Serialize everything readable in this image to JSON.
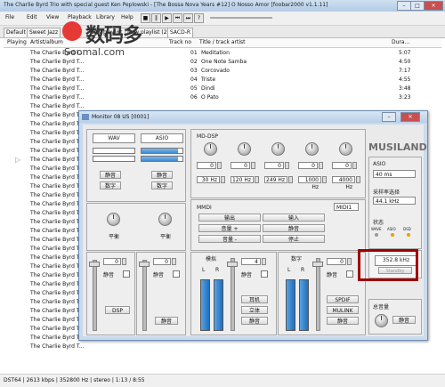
{
  "window": {
    "title": "The Charlie Byrd Trio with special guest Ken Peplowski - [The Bossa Nova Years #12] O Nosso Amor   [foobar2000 v1.1.11]"
  },
  "menu": [
    "File",
    "Edit",
    "View",
    "Playback",
    "Library",
    "Help"
  ],
  "tabs": [
    "Default",
    "Sweet Jazz",
    "New playlist",
    "New playlist (2)",
    "SACD-R"
  ],
  "active_tab": "SACD-R",
  "columns": {
    "playing": "Playing",
    "artist_album": "Artist/album",
    "track_no": "Track no",
    "title_artist": "Title / track artist",
    "duration": "Dura..."
  },
  "tracks": [
    {
      "artist": "The Charlie Byrd T...",
      "no": "01",
      "title": "Meditation",
      "dur": "5:07"
    },
    {
      "artist": "The Charlie Byrd T...",
      "no": "02",
      "title": "One Note Samba",
      "dur": "4:50"
    },
    {
      "artist": "The Charlie Byrd T...",
      "no": "03",
      "title": "Corcovado",
      "dur": "7:17"
    },
    {
      "artist": "The Charlie Byrd T...",
      "no": "04",
      "title": "Triste",
      "dur": "4:55"
    },
    {
      "artist": "The Charlie Byrd T...",
      "no": "05",
      "title": "Dindi",
      "dur": "3:48"
    },
    {
      "artist": "The Charlie Byrd T...",
      "no": "06",
      "title": "O Pato",
      "dur": "3:23"
    },
    {
      "artist": "The Charlie Byrd T...",
      "no": "",
      "title": "",
      "dur": ""
    },
    {
      "artist": "The Charlie Byrd T...",
      "no": "",
      "title": "",
      "dur": ""
    },
    {
      "artist": "The Charlie Byrd T...",
      "no": "",
      "title": "",
      "dur": ""
    },
    {
      "artist": "The Charlie Byrd T...",
      "no": "",
      "title": "",
      "dur": ""
    },
    {
      "artist": "The Charlie Byrd T...",
      "no": "",
      "title": "",
      "dur": ""
    },
    {
      "artist": "The Charlie Byrd T...",
      "no": "",
      "title": "",
      "dur": ""
    },
    {
      "artist": "The Charlie Byrd T...",
      "no": "",
      "title": "",
      "dur": ""
    },
    {
      "artist": "The Charlie Byrd T...",
      "no": "",
      "title": "",
      "dur": ""
    },
    {
      "artist": "The Charlie Byrd T...",
      "no": "",
      "title": "",
      "dur": ""
    },
    {
      "artist": "The Charlie Byrd T...",
      "no": "",
      "title": "",
      "dur": ""
    },
    {
      "artist": "The Charlie Byrd T...",
      "no": "",
      "title": "",
      "dur": ""
    },
    {
      "artist": "The Charlie Byrd T...",
      "no": "",
      "title": "",
      "dur": ""
    },
    {
      "artist": "The Charlie Byrd T...",
      "no": "",
      "title": "",
      "dur": ""
    },
    {
      "artist": "The Charlie Byrd T...",
      "no": "",
      "title": "",
      "dur": ""
    },
    {
      "artist": "The Charlie Byrd T...",
      "no": "",
      "title": "",
      "dur": ""
    },
    {
      "artist": "The Charlie Byrd T...",
      "no": "",
      "title": "",
      "dur": ""
    },
    {
      "artist": "The Charlie Byrd T...",
      "no": "",
      "title": "",
      "dur": ""
    },
    {
      "artist": "The Charlie Byrd T...",
      "no": "",
      "title": "",
      "dur": ""
    },
    {
      "artist": "The Charlie Byrd T...",
      "no": "",
      "title": "",
      "dur": ""
    },
    {
      "artist": "The Charlie Byrd T...",
      "no": "",
      "title": "",
      "dur": ""
    },
    {
      "artist": "The Charlie Byrd T...",
      "no": "",
      "title": "",
      "dur": ""
    },
    {
      "artist": "The Charlie Byrd T...",
      "no": "",
      "title": "",
      "dur": ""
    },
    {
      "artist": "The Charlie Byrd T...",
      "no": "",
      "title": "",
      "dur": ""
    },
    {
      "artist": "The Charlie Byrd T...",
      "no": "",
      "title": "",
      "dur": ""
    },
    {
      "artist": "The Charlie Byrd T...",
      "no": "",
      "title": "",
      "dur": ""
    },
    {
      "artist": "The Charlie Byrd T...",
      "no": "",
      "title": "",
      "dur": ""
    },
    {
      "artist": "The Charlie Byrd T...",
      "no": "",
      "title": "",
      "dur": ""
    },
    {
      "artist": "The Charlie Byrd T...",
      "no": "",
      "title": "",
      "dur": ""
    }
  ],
  "status": "DST64 | 2613 kbps | 352800 Hz | stereo | 1:13 / 8:55",
  "watermark": {
    "cn": "数码多",
    "en": "Soomal.com"
  },
  "monitor": {
    "title": "Monitor 08 US [0001]",
    "logo": "MUSILAND",
    "wav_label": "WAV",
    "asio_label": "ASIO",
    "wav_meter_level": 0.0,
    "asio_meter_level": 0.9,
    "btn_mute1": "静音",
    "btn_digital1": "数字",
    "btn_mute2": "静音",
    "btn_digital2": "数字",
    "balance1": "平衡",
    "balance2": "平衡",
    "eq_label": "MD-DSP",
    "eq_gains": [
      "0",
      "0",
      "0",
      "0",
      "0"
    ],
    "eq_freqs": [
      "30 Hz",
      "120 Hz",
      "249 Hz",
      "1000 Hz",
      "4000 Hz"
    ],
    "mmdi_label": "MMDI",
    "mmdi_select": "MIDI1",
    "btn_output": "输出",
    "btn_input": "输入",
    "btn_vol_plus": "音量 +",
    "btn_mute3": "静音",
    "btn_vol_minus": "音量 -",
    "btn_stop": "停止",
    "asio_right_label": "ASIO",
    "asio_latency": "40 ms",
    "sample_rate_label": "采样率选择",
    "sample_rate": "44.1 kHz",
    "state_label": "状态",
    "state_flags": [
      "WAVE",
      "ASIO",
      "DSD"
    ],
    "current_rate": "352.8 kHz",
    "standby_label": "Standby",
    "ch1_value": "0",
    "ch1_mute_label": "静音",
    "dsp_label": "DSP",
    "ch2_value": "0",
    "ch2_mute_label": "静音",
    "sim_label": "模拟",
    "ch3_value": "4",
    "ch3_mute_label": "静音",
    "L": "L",
    "R": "R",
    "btn_headphone": "耳机",
    "btn_stereo": "立体",
    "btn_mute4": "静音",
    "digital_label": "数字",
    "ch4_value": "0",
    "ch4_mute_label": "静音",
    "spdif": "SPDIF",
    "mulink": "MULINK",
    "btn_mute5": "静音",
    "master_label": "总音量",
    "btn_mute6": "静音"
  }
}
